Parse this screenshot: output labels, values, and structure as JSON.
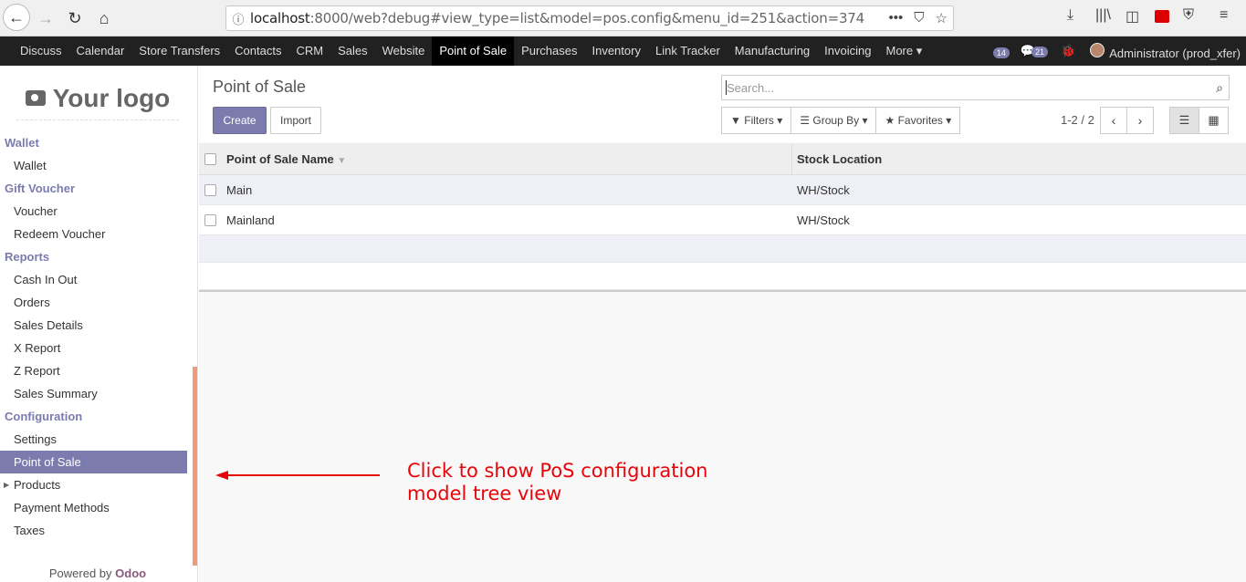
{
  "browser": {
    "url_host": "localhost",
    "url_rest": ":8000/web?debug#view_type=list&model=pos.config&menu_id=251&action=374"
  },
  "topnav": {
    "items": [
      "Discuss",
      "Calendar",
      "Store Transfers",
      "Contacts",
      "CRM",
      "Sales",
      "Website",
      "Point of Sale",
      "Purchases",
      "Inventory",
      "Link Tracker",
      "Manufacturing",
      "Invoicing",
      "More ▾"
    ],
    "active": "Point of Sale",
    "activity_count": "14",
    "message_count": "21",
    "user": "Administrator (prod_xfer)"
  },
  "sidebar": {
    "logo_text": "Your logo",
    "sections": [
      {
        "header": "Wallet",
        "items": [
          "Wallet"
        ]
      },
      {
        "header": "Gift Voucher",
        "items": [
          "Voucher",
          "Redeem Voucher"
        ]
      },
      {
        "header": "Reports",
        "items": [
          "Cash In Out",
          "Orders",
          "Sales Details",
          "X Report",
          "Z Report",
          "Sales Summary"
        ]
      },
      {
        "header": "Configuration",
        "items": [
          "Settings",
          "Point of Sale",
          "Products",
          "Payment Methods",
          "Taxes"
        ]
      }
    ],
    "active_item": "Point of Sale",
    "powered_prefix": "Powered by",
    "powered_brand": "Odoo"
  },
  "control_panel": {
    "breadcrumb": "Point of Sale",
    "create_label": "Create",
    "import_label": "Import",
    "search_placeholder": "Search...",
    "filters_label": "Filters",
    "groupby_label": "Group By",
    "favorites_label": "Favorites",
    "pager": "1-2 / 2"
  },
  "table": {
    "columns": [
      "Point of Sale Name",
      "Stock Location"
    ],
    "rows": [
      {
        "name": "Main",
        "location": "WH/Stock"
      },
      {
        "name": "Mainland",
        "location": "WH/Stock"
      }
    ]
  },
  "annotation": {
    "line1": "Click to show PoS configuration",
    "line2": "model tree view",
    "color": "#e8050a"
  },
  "colors": {
    "accent": "#7c7bad",
    "topbar": "#212121"
  }
}
